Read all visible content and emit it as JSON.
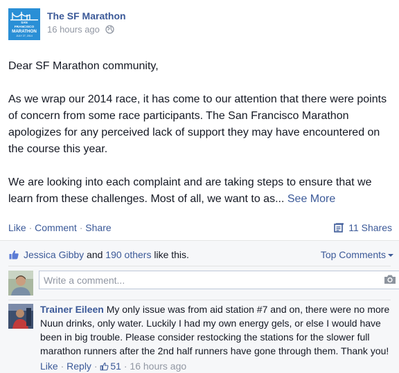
{
  "post": {
    "page_name": "The SF Marathon",
    "timestamp": "16 hours ago",
    "logo": {
      "lines": [
        "SAN",
        "FRANCISCO",
        "MARATHON",
        "JULY 27, 2014"
      ],
      "color": "#2a8fd6"
    },
    "paragraphs": [
      "Dear SF Marathon community,",
      "As we wrap our 2014 race, it has come to our attention that there were points of concern from some race participants. The San Francisco Marathon apologizes for any perceived lack of support they may have encountered on the course this year.",
      "We are looking into each complaint and are taking steps to ensure that we learn from these challenges. Most of all, we want to as..."
    ],
    "see_more": "See More"
  },
  "actions": {
    "like": "Like",
    "comment": "Comment",
    "share": "Share",
    "separator": " · ",
    "shares_count": "11 Shares"
  },
  "likes": {
    "first_name": "Jessica Gibby",
    "and_text": " and ",
    "others": "190 others",
    "suffix": " like this.",
    "top_comments": "Top Comments"
  },
  "composer": {
    "placeholder": "Write a comment..."
  },
  "comment": {
    "author": "Trainer Eileen",
    "text": " My only issue was from aid station #7 and on, there were no more Nuun drinks, only water. Luckily I had my own energy gels, or else I would have been in big trouble. Please consider restocking the stations for the slower full marathon runners after the 2nd half runners have gone through them. Thank you!",
    "like": "Like",
    "reply": "Reply",
    "like_count": "51",
    "timestamp": "16 hours ago",
    "separator": " · "
  },
  "colors": {
    "link": "#3b5998",
    "meta": "#9197a3",
    "text": "#141823",
    "feedback_bg": "#f6f7f9"
  },
  "icons": [
    "globe-icon",
    "share-icon",
    "like-icon",
    "camera-icon",
    "thumb-icon",
    "caret-down-icon"
  ]
}
